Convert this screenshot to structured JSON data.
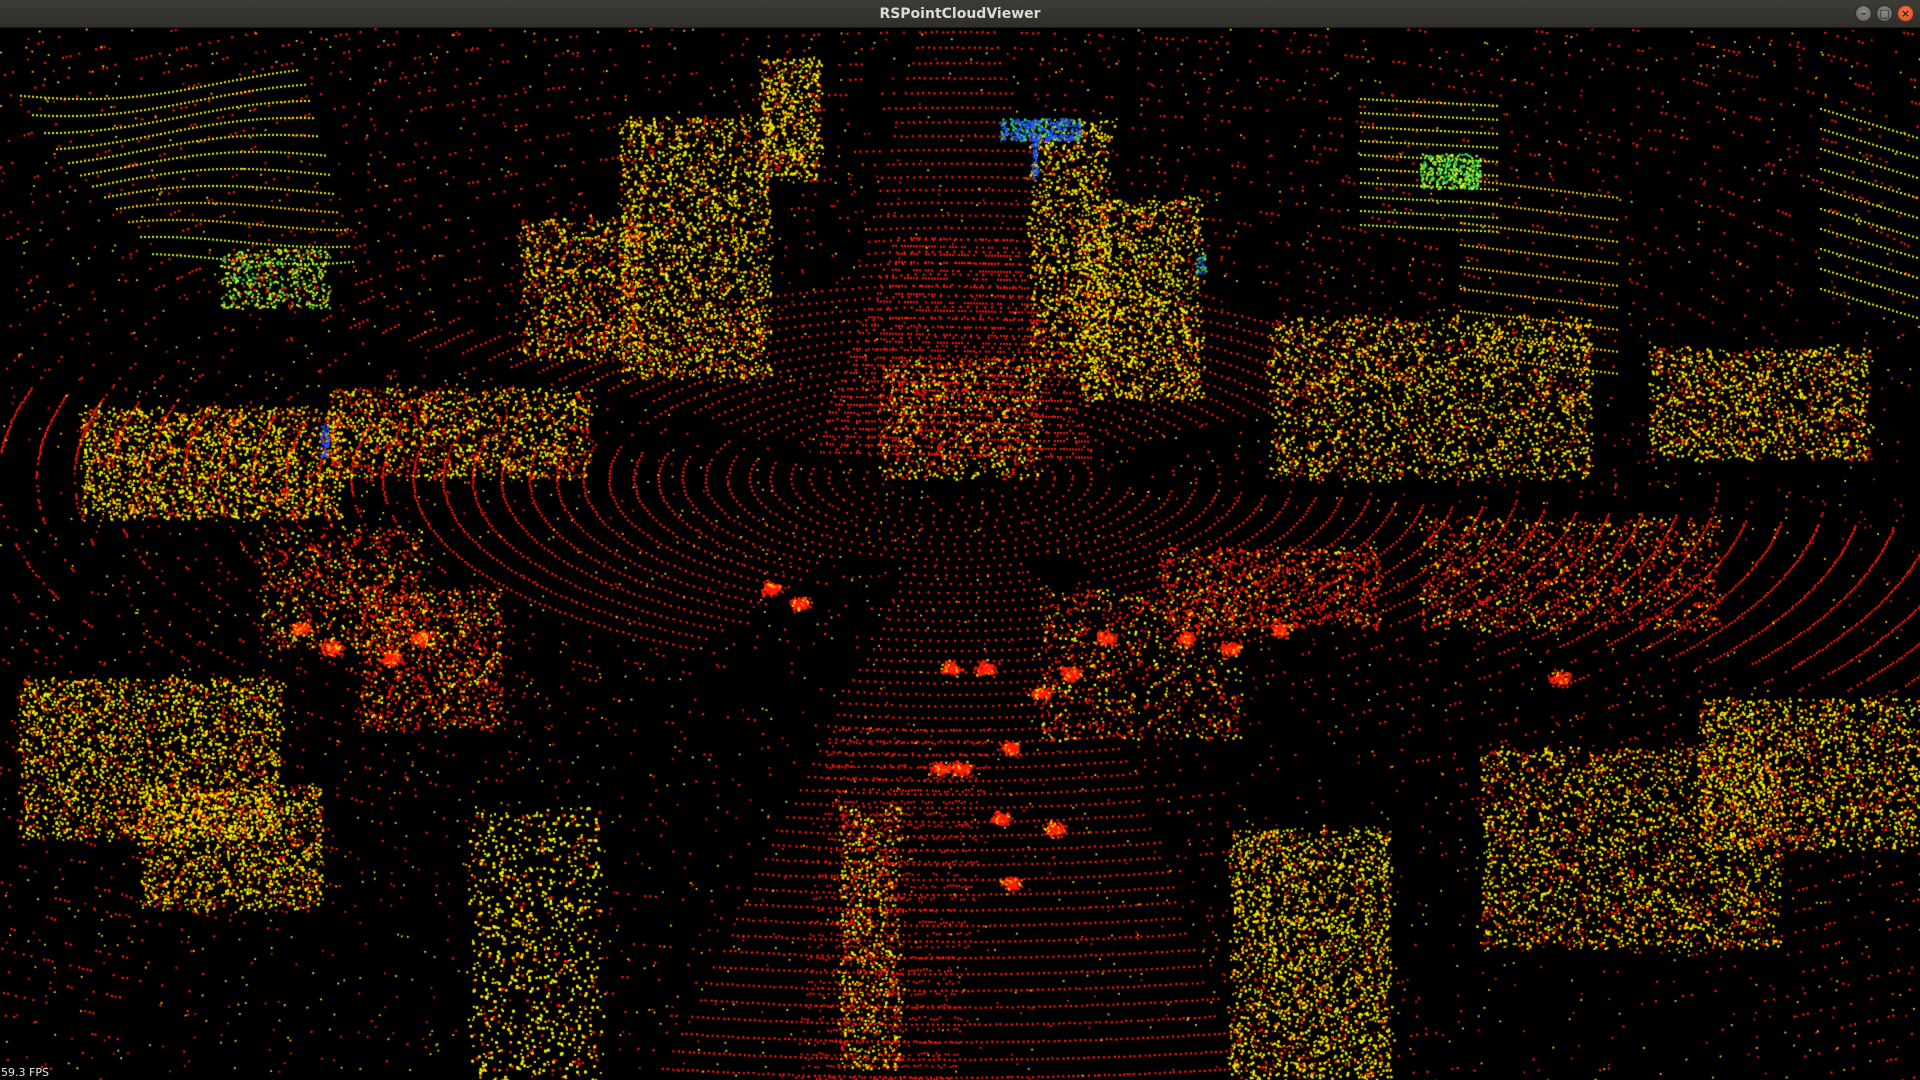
{
  "window": {
    "title": "RSPointCloudViewer",
    "buttons": {
      "minimize_glyph": "–",
      "maximize_glyph": "□",
      "close_glyph": "×"
    }
  },
  "viewer": {
    "fps_text": "59.3 FPS",
    "background_color": "#000000",
    "point_colors": {
      "ground": "#ff1a0a",
      "low": "#e01400",
      "mid": "#ffd200",
      "high": "#f4f400",
      "canopy": "#c8ff1e",
      "elevated": "#2ee65a",
      "top": "#2050ff"
    }
  }
}
